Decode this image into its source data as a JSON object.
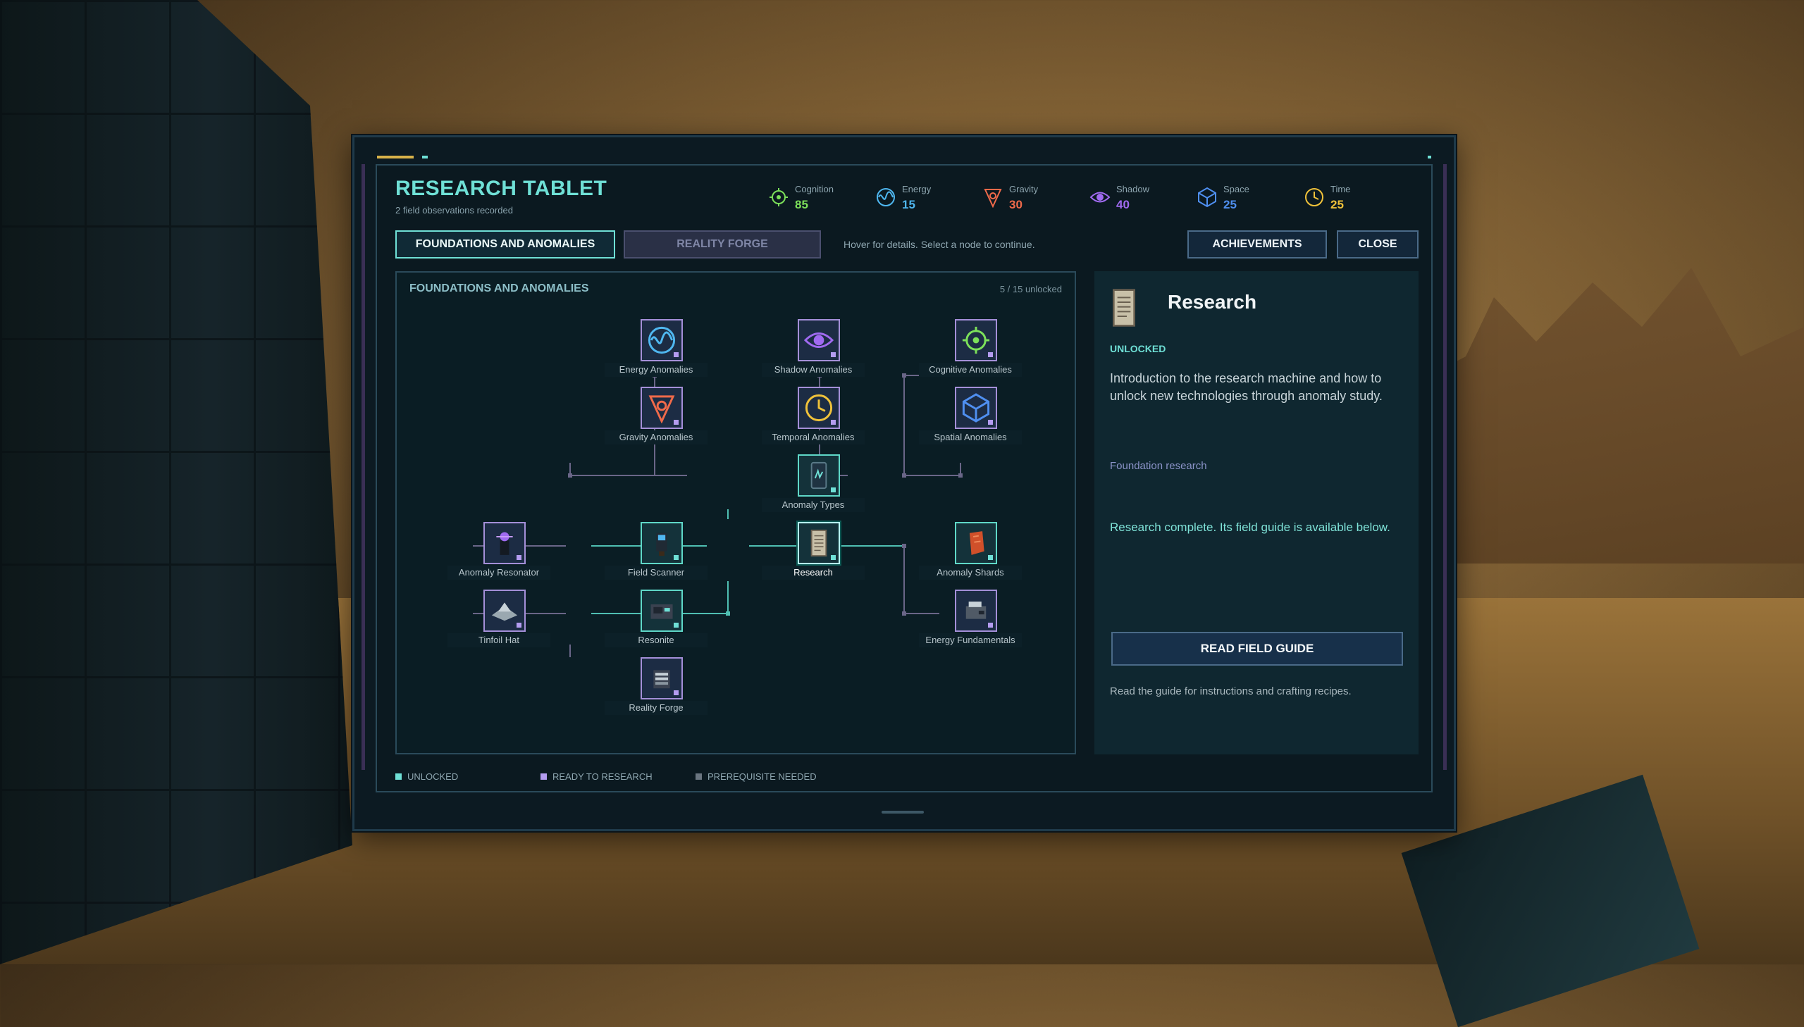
{
  "header": {
    "title": "RESEARCH TABLET",
    "subtitle": "2 field observations recorded"
  },
  "stats": [
    {
      "label": "Cognition",
      "value": "85",
      "icon": "cognition-icon",
      "color": "#7ce05a"
    },
    {
      "label": "Energy",
      "value": "15",
      "icon": "energy-icon",
      "color": "#4fb7f0"
    },
    {
      "label": "Gravity",
      "value": "30",
      "icon": "gravity-icon",
      "color": "#f06a4a"
    },
    {
      "label": "Shadow",
      "value": "40",
      "icon": "shadow-icon",
      "color": "#a06af0"
    },
    {
      "label": "Space",
      "value": "25",
      "icon": "space-icon",
      "color": "#4f8ff0"
    },
    {
      "label": "Time",
      "value": "25",
      "icon": "time-icon",
      "color": "#f0c23a"
    }
  ],
  "tabs": {
    "active": "FOUNDATIONS AND ANOMALIES",
    "inactive": "REALITY FORGE"
  },
  "hint": "Hover for details. Select a node to continue.",
  "buttons": {
    "achievements": "ACHIEVEMENTS",
    "close": "CLOSE"
  },
  "tree": {
    "title": "FOUNDATIONS AND ANOMALIES",
    "count": "5 / 15 unlocked",
    "nodes": [
      {
        "label": "Energy Anomalies",
        "state": "ready"
      },
      {
        "label": "Shadow Anomalies",
        "state": "ready"
      },
      {
        "label": "Cognitive Anomalies",
        "state": "ready"
      },
      {
        "label": "Gravity Anomalies",
        "state": "ready"
      },
      {
        "label": "Temporal Anomalies",
        "state": "ready"
      },
      {
        "label": "Spatial Anomalies",
        "state": "ready"
      },
      {
        "label": "Anomaly Types",
        "state": "unlocked"
      },
      {
        "label": "Anomaly Resonator",
        "state": "ready"
      },
      {
        "label": "Field Scanner",
        "state": "unlocked"
      },
      {
        "label": "Research",
        "state": "unlocked"
      },
      {
        "label": "Anomaly Shards",
        "state": "unlocked"
      },
      {
        "label": "Tinfoil Hat",
        "state": "ready"
      },
      {
        "label": "Resonite",
        "state": "unlocked"
      },
      {
        "label": "Energy Fundamentals",
        "state": "ready"
      },
      {
        "label": "Reality Forge",
        "state": "ready"
      }
    ]
  },
  "legend": {
    "unlocked": "UNLOCKED",
    "ready": "READY TO RESEARCH",
    "prereq": "PREREQUISITE NEEDED"
  },
  "colors": {
    "unlocked": "#6fe0d6",
    "ready": "#b49cf0",
    "prereq": "#6a7580"
  },
  "detail": {
    "name": "Research",
    "status": "UNLOCKED",
    "description": "Introduction to the research machine and how to unlock new technologies through anomaly study.",
    "category": "Foundation research",
    "note": "Research complete. Its field guide is available below.",
    "button": "READ FIELD GUIDE",
    "footer": "Read the guide for instructions and crafting recipes."
  }
}
